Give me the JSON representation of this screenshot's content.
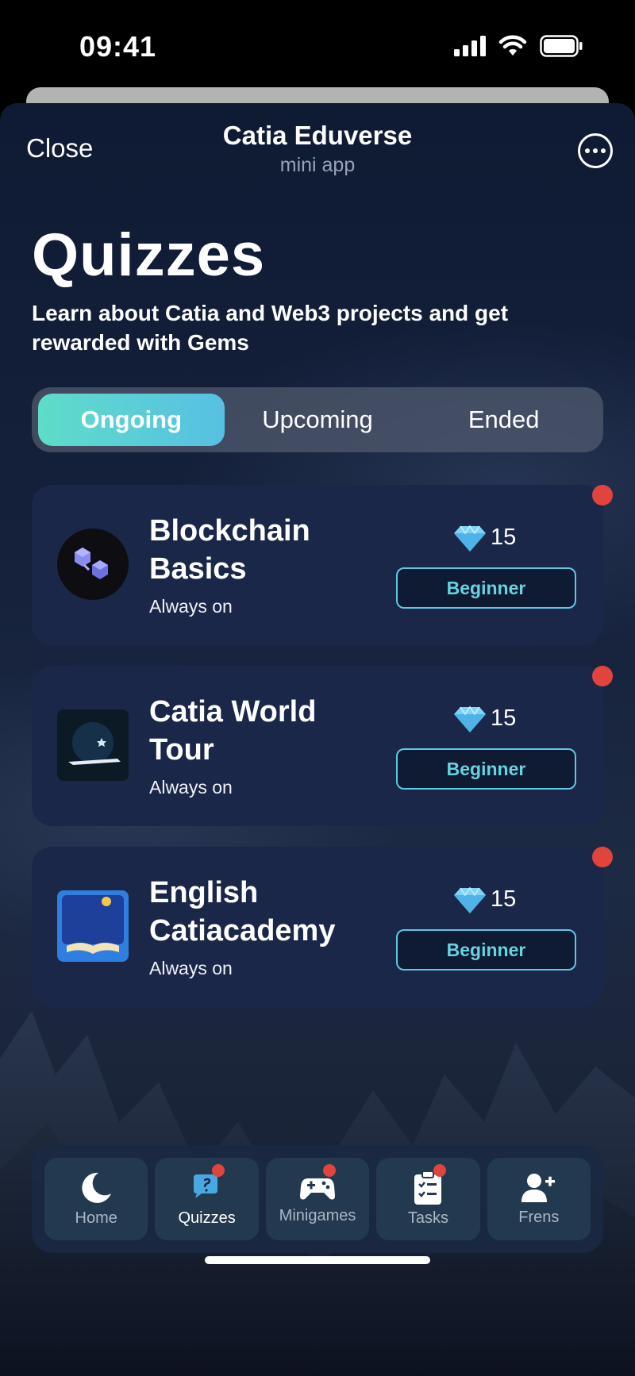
{
  "status_bar": {
    "time": "09:41"
  },
  "header": {
    "close_label": "Close",
    "title": "Catia Eduverse",
    "subtitle": "mini app"
  },
  "page": {
    "title": "Quizzes",
    "subtitle": "Learn about Catia and Web3 projects and get rewarded with Gems"
  },
  "tabs": [
    {
      "label": "Ongoing",
      "active": true
    },
    {
      "label": "Upcoming",
      "active": false
    },
    {
      "label": "Ended",
      "active": false
    }
  ],
  "quizzes": [
    {
      "title": "Blockchain Basics",
      "status": "Always on",
      "reward": "15",
      "level": "Beginner",
      "icon": "blockchain-cubes-icon"
    },
    {
      "title": "Catia World Tour",
      "status": "Always on",
      "reward": "15",
      "level": "Beginner",
      "icon": "world-tour-icon"
    },
    {
      "title": "English Catiacademy",
      "status": "Always on",
      "reward": "15",
      "level": "Beginner",
      "icon": "english-academy-icon"
    }
  ],
  "nav": [
    {
      "label": "Home",
      "icon": "moon-icon",
      "active": false,
      "badge": false
    },
    {
      "label": "Quizzes",
      "icon": "quiz-bubble-icon",
      "active": true,
      "badge": true
    },
    {
      "label": "Minigames",
      "icon": "gamepad-icon",
      "active": false,
      "badge": true
    },
    {
      "label": "Tasks",
      "icon": "clipboard-icon",
      "active": false,
      "badge": true
    },
    {
      "label": "Frens",
      "icon": "add-friend-icon",
      "active": false,
      "badge": false
    }
  ],
  "colors": {
    "accent_start": "#5fdcc9",
    "accent_end": "#57c0e3",
    "notification": "#e0443c",
    "card_bg": "#1a2748"
  }
}
